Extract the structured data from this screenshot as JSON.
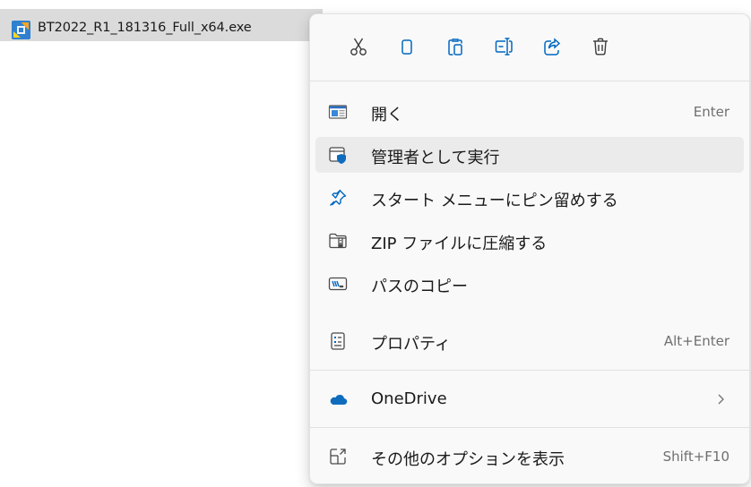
{
  "file": {
    "name": "BT2022_R1_181316_Full_x64.exe",
    "icon": "installer-icon"
  },
  "toolbar": {
    "buttons": [
      {
        "icon": "cut-icon"
      },
      {
        "icon": "copy-icon"
      },
      {
        "icon": "paste-icon"
      },
      {
        "icon": "rename-icon"
      },
      {
        "icon": "share-icon"
      },
      {
        "icon": "delete-icon"
      }
    ]
  },
  "menu": {
    "items": [
      {
        "label": "開く",
        "shortcut": "Enter",
        "icon": "open-window-icon"
      },
      {
        "label": "管理者として実行",
        "shortcut": "",
        "icon": "run-as-admin-shield-icon"
      },
      {
        "label": "スタート メニューにピン留めする",
        "shortcut": "",
        "icon": "pin-icon"
      },
      {
        "label": "ZIP ファイルに圧縮する",
        "shortcut": "",
        "icon": "zip-folder-icon"
      },
      {
        "label": "パスのコピー",
        "shortcut": "",
        "icon": "copy-path-icon"
      },
      {
        "label": "プロパティ",
        "shortcut": "Alt+Enter",
        "icon": "properties-icon"
      },
      {
        "label": "OneDrive",
        "shortcut": "",
        "icon": "onedrive-cloud-icon"
      },
      {
        "label": "その他のオプションを表示",
        "shortcut": "Shift+F10",
        "icon": "more-options-icon"
      }
    ]
  },
  "colors": {
    "accent": "#0067c0",
    "onedrive": "#0f6cbd",
    "hover": "#ebebeb",
    "selection": "#dbdbdb"
  }
}
